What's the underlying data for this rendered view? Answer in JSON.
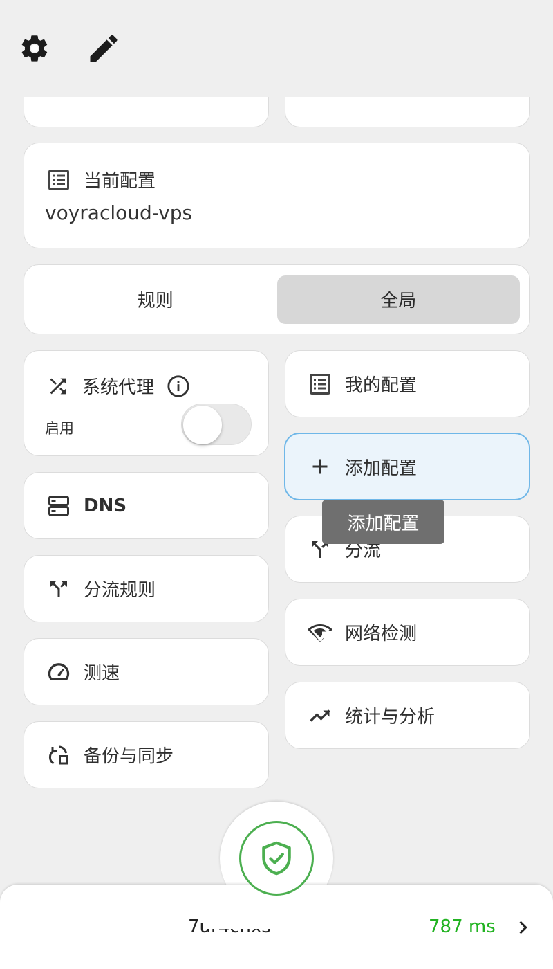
{
  "topbar": {
    "settings_icon": "gear-icon",
    "edit_icon": "pencil-icon"
  },
  "current_profile": {
    "title": "当前配置",
    "value": "voyracloud-vps"
  },
  "mode": {
    "rule": "规则",
    "global": "全局",
    "selected": "global"
  },
  "system_proxy": {
    "title": "系统代理",
    "status": "启用",
    "enabled": false
  },
  "tiles": {
    "my_profiles": "我的配置",
    "add_profile": "添加配置",
    "dns": "DNS",
    "split": "分流",
    "split_rules": "分流规则",
    "network_check": "网络检测",
    "speed_test": "测速",
    "stats": "统计与分析",
    "backup_sync": "备份与同步"
  },
  "tooltip": {
    "text": "添加配置"
  },
  "footer": {
    "node_name": "7ur4cnxs",
    "latency": "787 ms",
    "latency_color": "#22b322"
  },
  "colors": {
    "accent_green": "#4caf50",
    "selected_border": "#6fb7e8",
    "selected_bg": "#ebf4fb"
  }
}
